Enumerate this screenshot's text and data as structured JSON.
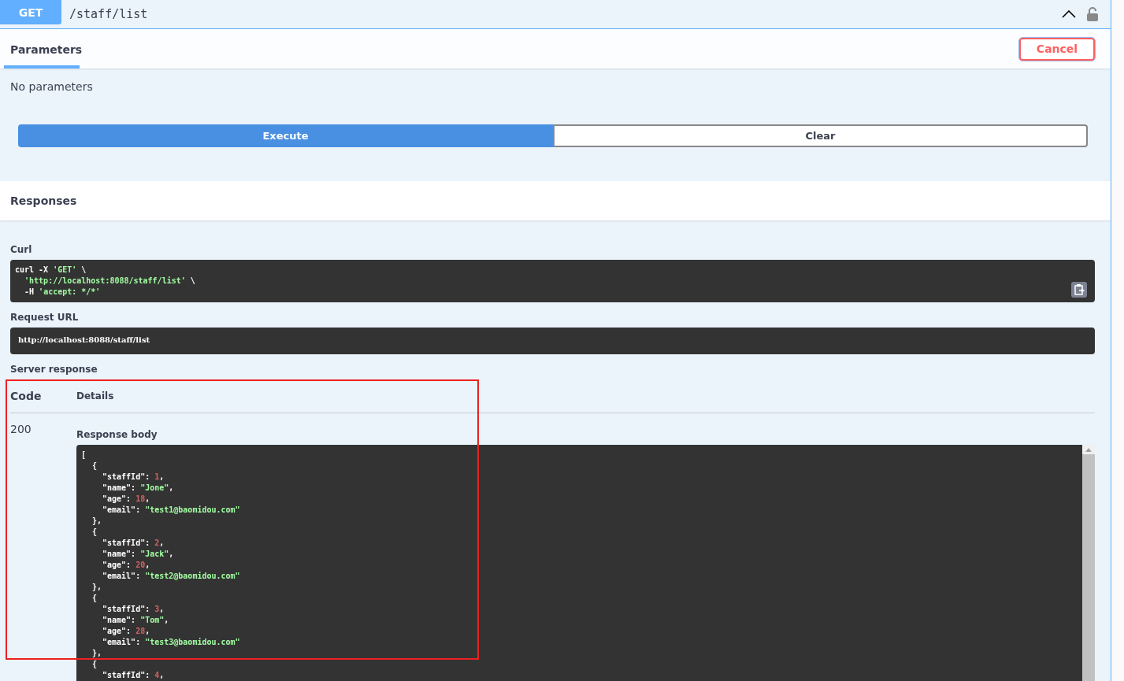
{
  "operation": {
    "method": "GET",
    "path": "/staff/list"
  },
  "parameters": {
    "tab": {
      "label": "Parameters",
      "selected": true
    },
    "cancel": "Cancel",
    "empty": "No parameters"
  },
  "actions": {
    "execute": "Execute",
    "clear": "Clear"
  },
  "responses": {
    "title": "Responses",
    "curl_label": "Curl",
    "curl_lines": [
      [
        {
          "text": "curl -X ",
          "kind": "plain"
        },
        {
          "text": "'GET'",
          "kind": "string"
        },
        {
          "text": " \\",
          "kind": "plain"
        }
      ],
      [
        {
          "text": "  'http://localhost:8088/staff/list'",
          "kind": "string"
        },
        {
          "text": " \\",
          "kind": "plain"
        }
      ],
      [
        {
          "text": "  -H ",
          "kind": "plain"
        },
        {
          "text": "'accept: */*'",
          "kind": "string"
        }
      ]
    ],
    "request_url_label": "Request URL",
    "request_url": "http://localhost:8088/staff/list",
    "server_response_label": "Server response",
    "columns": [
      "Code",
      "Details"
    ],
    "code": "200",
    "body_label": "Response body",
    "body": {
      "open": "[",
      "items": [
        {
          "open": "{",
          "close": "},",
          "fields": [
            {
              "key": "\"staffId\":",
              "value": "1",
              "kind": "number",
              "tail": ","
            },
            {
              "key": "\"name\":",
              "value": "\"Jone\"",
              "kind": "string",
              "tail": ","
            },
            {
              "key": "\"age\":",
              "value": "18",
              "kind": "number",
              "tail": ","
            },
            {
              "key": "\"email\":",
              "value": "\"test1@baomidou.com\"",
              "kind": "string"
            }
          ]
        },
        {
          "open": "{",
          "close": "},",
          "fields": [
            {
              "key": "\"staffId\":",
              "value": "2",
              "kind": "number",
              "tail": ","
            },
            {
              "key": "\"name\":",
              "value": "\"Jack\"",
              "kind": "string",
              "tail": ","
            },
            {
              "key": "\"age\":",
              "value": "20",
              "kind": "number",
              "tail": ","
            },
            {
              "key": "\"email\":",
              "value": "\"test2@baomidou.com\"",
              "kind": "string"
            }
          ]
        },
        {
          "open": "{",
          "close": "},",
          "fields": [
            {
              "key": "\"staffId\":",
              "value": "3",
              "kind": "number",
              "tail": ","
            },
            {
              "key": "\"name\":",
              "value": "\"Tom\"",
              "kind": "string",
              "tail": ","
            },
            {
              "key": "\"age\":",
              "value": "28",
              "kind": "number",
              "tail": ","
            },
            {
              "key": "\"email\":",
              "value": "\"test3@baomidou.com\"",
              "kind": "string"
            }
          ]
        },
        {
          "open": "{",
          "fields": [
            {
              "key": "\"staffId\":",
              "value": "4",
              "kind": "number",
              "tail": ","
            }
          ]
        }
      ]
    }
  }
}
